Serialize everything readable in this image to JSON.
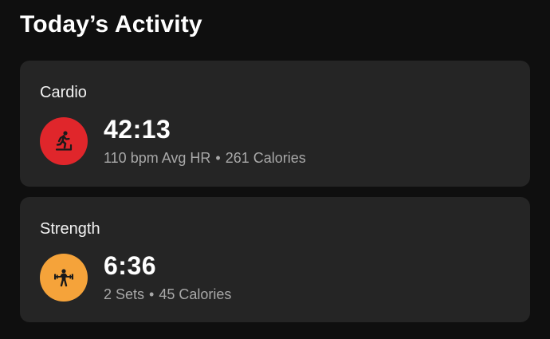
{
  "page": {
    "title": "Today’s Activity"
  },
  "colors": {
    "background": "#0f0f0f",
    "card": "#252525",
    "cardio_accent": "#e0262b",
    "strength_accent": "#f5a33a",
    "secondary_text": "#a8a8a8"
  },
  "cards": [
    {
      "title": "Cardio",
      "icon": "runner-icon",
      "duration": "42:13",
      "stat1": "110 bpm Avg HR",
      "separator": "•",
      "stat2": "261 Calories"
    },
    {
      "title": "Strength",
      "icon": "weightlifter-icon",
      "duration": "6:36",
      "stat1": "2 Sets",
      "separator": "•",
      "stat2": "45 Calories"
    }
  ]
}
